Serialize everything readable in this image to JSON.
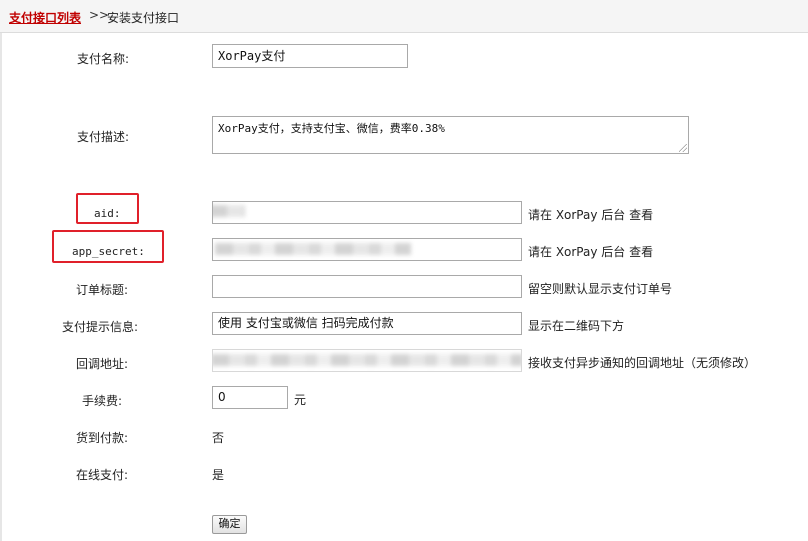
{
  "breadcrumb": {
    "link": "支付接口列表",
    "separator": ">>",
    "current": "安装支付接口"
  },
  "form": {
    "pay_name": {
      "label": "支付名称:",
      "value": "XorPay支付"
    },
    "pay_desc": {
      "label": "支付描述:",
      "value": "XorPay支付，支持支付宝、微信，费率0.38%"
    },
    "aid": {
      "label": "aid:",
      "hint": "请在 XorPay 后台 查看"
    },
    "app_secret": {
      "label": "app_secret:",
      "hint": "请在 XorPay 后台 查看"
    },
    "order_title": {
      "label": "订单标题:",
      "value": "",
      "hint": "留空则默认显示支付订单号"
    },
    "pay_tip": {
      "label": "支付提示信息:",
      "value": "使用 支付宝或微信 扫码完成付款",
      "hint": "显示在二维码下方"
    },
    "callback": {
      "label": "回调地址:",
      "hint": "接收支付异步通知的回调地址（无须修改）"
    },
    "fee": {
      "label": "手续费:",
      "value": "0",
      "unit": "元"
    },
    "cod": {
      "label": "货到付款:",
      "value": "否"
    },
    "online": {
      "label": "在线支付:",
      "value": "是"
    },
    "submit_label": "确定"
  },
  "colors": {
    "highlight_box": "#e0202a",
    "breadcrumb_link": "#c00000"
  }
}
